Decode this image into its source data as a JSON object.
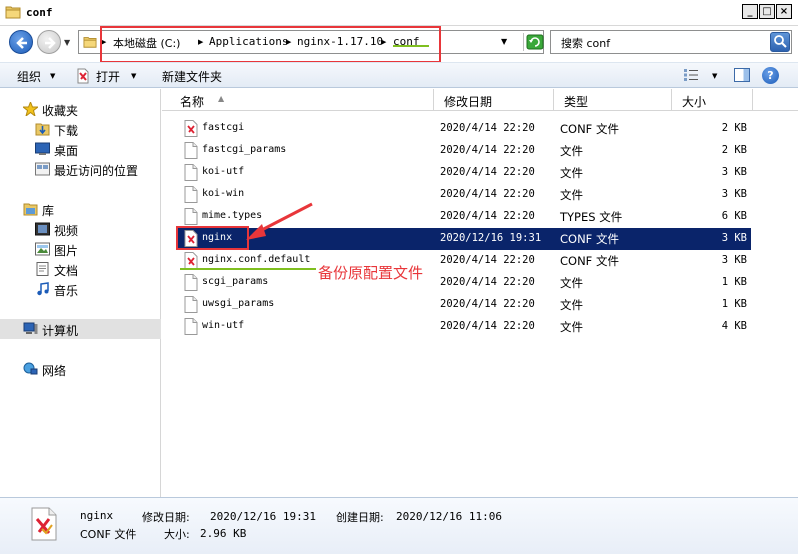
{
  "window": {
    "title": "conf"
  },
  "addressbar": {
    "crumbs": [
      "本地磁盘 (C:)",
      "Applications",
      "nginx-1.17.10",
      "conf"
    ]
  },
  "search": {
    "text": "搜索 conf"
  },
  "toolbar": {
    "organize": "组织",
    "open": "打开",
    "new_folder": "新建文件夹"
  },
  "sidebar": {
    "favorites": "收藏夹",
    "downloads": "下载",
    "desktop": "桌面",
    "recent": "最近访问的位置",
    "libraries": "库",
    "videos": "视频",
    "pictures": "图片",
    "documents": "文档",
    "music": "音乐",
    "computer": "计算机",
    "network": "网络"
  },
  "columns": {
    "name": "名称",
    "modified": "修改日期",
    "type": "类型",
    "size": "大小"
  },
  "files": [
    {
      "name": "fastcgi",
      "date": "2020/4/14 22:20",
      "type": "CONF 文件",
      "size": "2 KB",
      "icon": "conf-file-icon"
    },
    {
      "name": "fastcgi_params",
      "date": "2020/4/14 22:20",
      "type": "文件",
      "size": "2 KB",
      "icon": "blank-file-icon"
    },
    {
      "name": "koi-utf",
      "date": "2020/4/14 22:20",
      "type": "文件",
      "size": "3 KB",
      "icon": "blank-file-icon"
    },
    {
      "name": "koi-win",
      "date": "2020/4/14 22:20",
      "type": "文件",
      "size": "3 KB",
      "icon": "blank-file-icon"
    },
    {
      "name": "mime.types",
      "date": "2020/4/14 22:20",
      "type": "TYPES 文件",
      "size": "6 KB",
      "icon": "blank-file-icon"
    },
    {
      "name": "nginx",
      "date": "2020/12/16 19:31",
      "type": "CONF 文件",
      "size": "3 KB",
      "icon": "conf-file-icon",
      "selected": true
    },
    {
      "name": "nginx.conf.default",
      "date": "2020/4/14 22:20",
      "type": "CONF 文件",
      "size": "3 KB",
      "icon": "conf-file-icon"
    },
    {
      "name": "scgi_params",
      "date": "2020/4/14 22:20",
      "type": "文件",
      "size": "1 KB",
      "icon": "blank-file-icon"
    },
    {
      "name": "uwsgi_params",
      "date": "2020/4/14 22:20",
      "type": "文件",
      "size": "1 KB",
      "icon": "blank-file-icon"
    },
    {
      "name": "win-utf",
      "date": "2020/4/14 22:20",
      "type": "文件",
      "size": "4 KB",
      "icon": "blank-file-icon"
    }
  ],
  "annotation": {
    "text": "备份原配置文件",
    "color": "#e8363a",
    "underline_color": "#7fbf1f"
  },
  "details": {
    "name": "nginx",
    "type": "CONF 文件",
    "modified_label": "修改日期:",
    "modified_value": "2020/12/16 19:31",
    "created_label": "创建日期:",
    "created_value": "2020/12/16 11:06",
    "size_label": "大小:",
    "size_value": "2.96 KB"
  },
  "colors": {
    "selection": "#0a246a",
    "accent": "#1c5cb8"
  }
}
